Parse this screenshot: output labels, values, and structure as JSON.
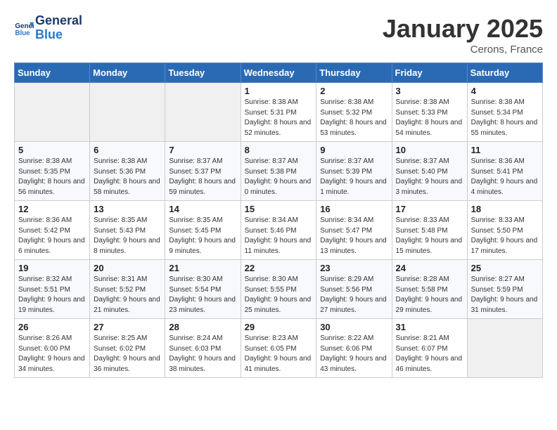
{
  "logo": {
    "line1": "General",
    "line2": "Blue"
  },
  "header": {
    "title": "January 2025",
    "location": "Cerons, France"
  },
  "weekdays": [
    "Sunday",
    "Monday",
    "Tuesday",
    "Wednesday",
    "Thursday",
    "Friday",
    "Saturday"
  ],
  "weeks": [
    [
      {
        "day": "",
        "info": ""
      },
      {
        "day": "",
        "info": ""
      },
      {
        "day": "",
        "info": ""
      },
      {
        "day": "1",
        "info": "Sunrise: 8:38 AM\nSunset: 5:31 PM\nDaylight: 8 hours and 52 minutes."
      },
      {
        "day": "2",
        "info": "Sunrise: 8:38 AM\nSunset: 5:32 PM\nDaylight: 8 hours and 53 minutes."
      },
      {
        "day": "3",
        "info": "Sunrise: 8:38 AM\nSunset: 5:33 PM\nDaylight: 8 hours and 54 minutes."
      },
      {
        "day": "4",
        "info": "Sunrise: 8:38 AM\nSunset: 5:34 PM\nDaylight: 8 hours and 55 minutes."
      }
    ],
    [
      {
        "day": "5",
        "info": "Sunrise: 8:38 AM\nSunset: 5:35 PM\nDaylight: 8 hours and 56 minutes."
      },
      {
        "day": "6",
        "info": "Sunrise: 8:38 AM\nSunset: 5:36 PM\nDaylight: 8 hours and 58 minutes."
      },
      {
        "day": "7",
        "info": "Sunrise: 8:37 AM\nSunset: 5:37 PM\nDaylight: 8 hours and 59 minutes."
      },
      {
        "day": "8",
        "info": "Sunrise: 8:37 AM\nSunset: 5:38 PM\nDaylight: 9 hours and 0 minutes."
      },
      {
        "day": "9",
        "info": "Sunrise: 8:37 AM\nSunset: 5:39 PM\nDaylight: 9 hours and 1 minute."
      },
      {
        "day": "10",
        "info": "Sunrise: 8:37 AM\nSunset: 5:40 PM\nDaylight: 9 hours and 3 minutes."
      },
      {
        "day": "11",
        "info": "Sunrise: 8:36 AM\nSunset: 5:41 PM\nDaylight: 9 hours and 4 minutes."
      }
    ],
    [
      {
        "day": "12",
        "info": "Sunrise: 8:36 AM\nSunset: 5:42 PM\nDaylight: 9 hours and 6 minutes."
      },
      {
        "day": "13",
        "info": "Sunrise: 8:35 AM\nSunset: 5:43 PM\nDaylight: 9 hours and 8 minutes."
      },
      {
        "day": "14",
        "info": "Sunrise: 8:35 AM\nSunset: 5:45 PM\nDaylight: 9 hours and 9 minutes."
      },
      {
        "day": "15",
        "info": "Sunrise: 8:34 AM\nSunset: 5:46 PM\nDaylight: 9 hours and 11 minutes."
      },
      {
        "day": "16",
        "info": "Sunrise: 8:34 AM\nSunset: 5:47 PM\nDaylight: 9 hours and 13 minutes."
      },
      {
        "day": "17",
        "info": "Sunrise: 8:33 AM\nSunset: 5:48 PM\nDaylight: 9 hours and 15 minutes."
      },
      {
        "day": "18",
        "info": "Sunrise: 8:33 AM\nSunset: 5:50 PM\nDaylight: 9 hours and 17 minutes."
      }
    ],
    [
      {
        "day": "19",
        "info": "Sunrise: 8:32 AM\nSunset: 5:51 PM\nDaylight: 9 hours and 19 minutes."
      },
      {
        "day": "20",
        "info": "Sunrise: 8:31 AM\nSunset: 5:52 PM\nDaylight: 9 hours and 21 minutes."
      },
      {
        "day": "21",
        "info": "Sunrise: 8:30 AM\nSunset: 5:54 PM\nDaylight: 9 hours and 23 minutes."
      },
      {
        "day": "22",
        "info": "Sunrise: 8:30 AM\nSunset: 5:55 PM\nDaylight: 9 hours and 25 minutes."
      },
      {
        "day": "23",
        "info": "Sunrise: 8:29 AM\nSunset: 5:56 PM\nDaylight: 9 hours and 27 minutes."
      },
      {
        "day": "24",
        "info": "Sunrise: 8:28 AM\nSunset: 5:58 PM\nDaylight: 9 hours and 29 minutes."
      },
      {
        "day": "25",
        "info": "Sunrise: 8:27 AM\nSunset: 5:59 PM\nDaylight: 9 hours and 31 minutes."
      }
    ],
    [
      {
        "day": "26",
        "info": "Sunrise: 8:26 AM\nSunset: 6:00 PM\nDaylight: 9 hours and 34 minutes."
      },
      {
        "day": "27",
        "info": "Sunrise: 8:25 AM\nSunset: 6:02 PM\nDaylight: 9 hours and 36 minutes."
      },
      {
        "day": "28",
        "info": "Sunrise: 8:24 AM\nSunset: 6:03 PM\nDaylight: 9 hours and 38 minutes."
      },
      {
        "day": "29",
        "info": "Sunrise: 8:23 AM\nSunset: 6:05 PM\nDaylight: 9 hours and 41 minutes."
      },
      {
        "day": "30",
        "info": "Sunrise: 8:22 AM\nSunset: 6:06 PM\nDaylight: 9 hours and 43 minutes."
      },
      {
        "day": "31",
        "info": "Sunrise: 8:21 AM\nSunset: 6:07 PM\nDaylight: 9 hours and 46 minutes."
      },
      {
        "day": "",
        "info": ""
      }
    ]
  ]
}
